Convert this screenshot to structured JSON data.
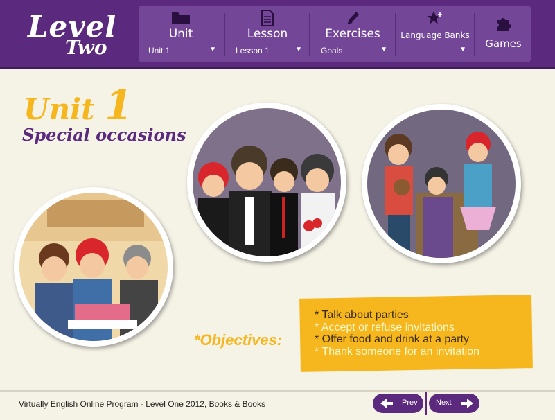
{
  "logo": {
    "line1": "Level",
    "line2": "Two"
  },
  "nav": [
    {
      "icon": "folder-icon",
      "title": "Unit",
      "selected": "Unit 1"
    },
    {
      "icon": "document-icon",
      "title": "Lesson",
      "selected": "Lesson 1"
    },
    {
      "icon": "pencil-icon",
      "title": "Exercises",
      "selected": "Goals"
    },
    {
      "icon": "star-plus-icon",
      "title": "Language Banks",
      "selected": ""
    },
    {
      "icon": "puzzle-icon",
      "title": "Games"
    }
  ],
  "unit": {
    "word": "Unit",
    "number": "1",
    "subtitle": "Special occasions"
  },
  "objectives": {
    "label": "*Objectives:",
    "items": [
      "* Talk about parties",
      "* Accept or refuse invitations",
      "* Offer food and drink at a party",
      "* Thank someone for an invitation"
    ]
  },
  "footer": {
    "credit": "Virtually English Online Program - Level One 2012, Books & Books",
    "prev": "Prev",
    "next": "Next"
  },
  "colors": {
    "header": "#5b2a7e",
    "accent": "#f5b61e",
    "highlight": "#fff8c8"
  }
}
